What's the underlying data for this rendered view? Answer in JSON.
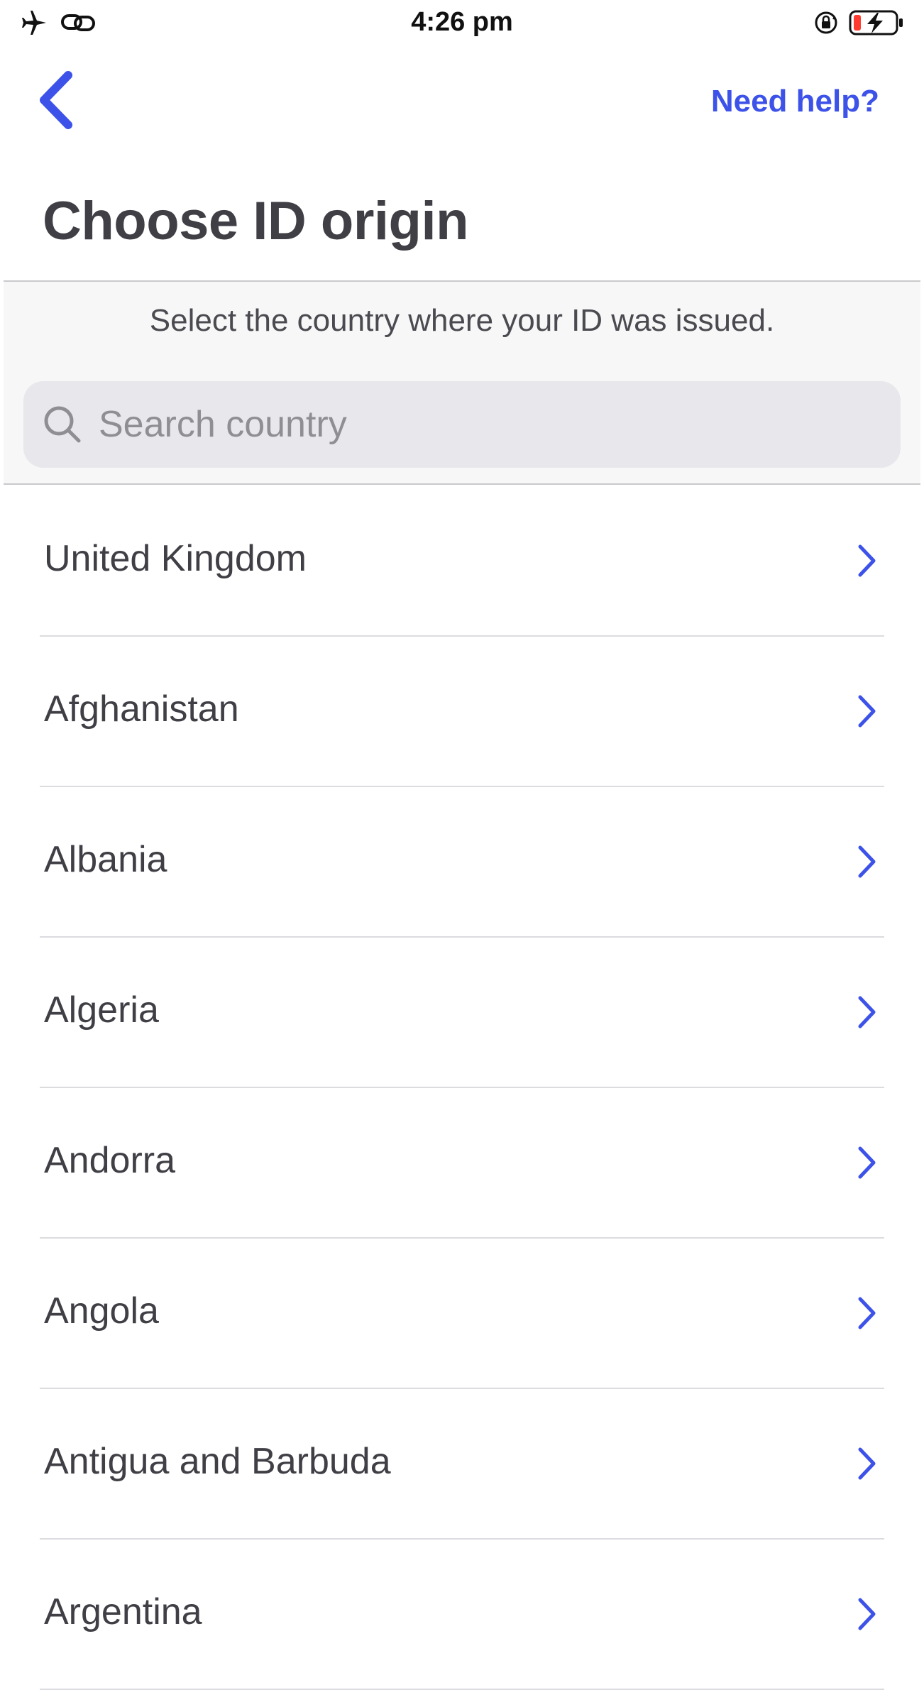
{
  "status_bar": {
    "time": "4:26 pm",
    "icons": [
      "airplane-mode-icon",
      "link-icon",
      "orientation-lock-icon",
      "battery-low-charging-icon"
    ]
  },
  "nav": {
    "help_label": "Need help?",
    "back_icon": "chevron-left-icon"
  },
  "page": {
    "title": "Choose ID origin",
    "hint": "Select the country where your ID was issued."
  },
  "search": {
    "placeholder": "Search country",
    "value": "",
    "icon": "search-icon"
  },
  "countries": [
    {
      "label": "United Kingdom"
    },
    {
      "label": "Afghanistan"
    },
    {
      "label": "Albania"
    },
    {
      "label": "Algeria"
    },
    {
      "label": "Andorra"
    },
    {
      "label": "Angola"
    },
    {
      "label": "Antigua and Barbuda"
    },
    {
      "label": "Argentina"
    }
  ],
  "colors": {
    "accent": "#3c52e8",
    "text": "#3f3f45",
    "battery_low": "#ff3b30"
  }
}
